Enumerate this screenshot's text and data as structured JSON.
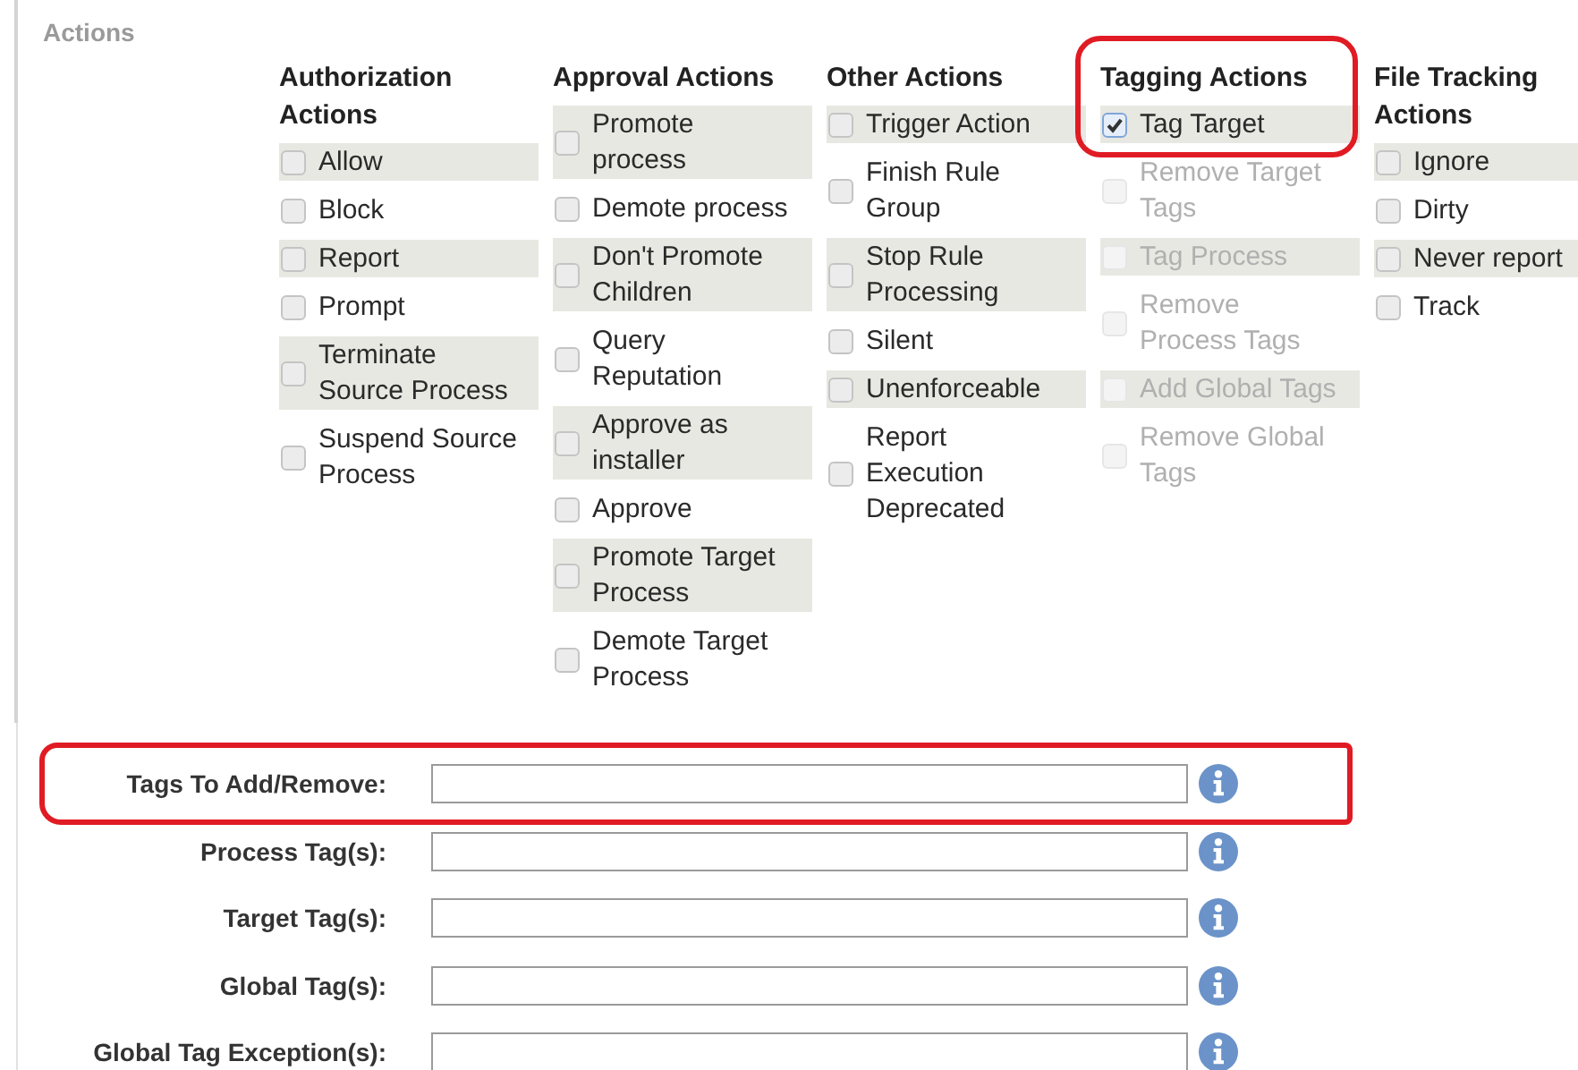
{
  "section": {
    "title": "Actions"
  },
  "action_groups": [
    {
      "title": "Authorization Actions",
      "highlighted": false,
      "options": [
        {
          "label": "Allow",
          "checked": false,
          "disabled": false
        },
        {
          "label": "Block",
          "checked": false,
          "disabled": false
        },
        {
          "label": "Report",
          "checked": false,
          "disabled": false
        },
        {
          "label": "Prompt",
          "checked": false,
          "disabled": false
        },
        {
          "label": "Terminate Source Process",
          "checked": false,
          "disabled": false
        },
        {
          "label": "Suspend Source Process",
          "checked": false,
          "disabled": false
        }
      ]
    },
    {
      "title": "Approval Actions",
      "highlighted": false,
      "options": [
        {
          "label": "Promote process",
          "checked": false,
          "disabled": false
        },
        {
          "label": "Demote process",
          "checked": false,
          "disabled": false
        },
        {
          "label": "Don't Promote Children",
          "checked": false,
          "disabled": false
        },
        {
          "label": "Query Reputation",
          "checked": false,
          "disabled": false
        },
        {
          "label": "Approve as installer",
          "checked": false,
          "disabled": false
        },
        {
          "label": "Approve",
          "checked": false,
          "disabled": false
        },
        {
          "label": "Promote Target Process",
          "checked": false,
          "disabled": false
        },
        {
          "label": "Demote Target Process",
          "checked": false,
          "disabled": false
        }
      ]
    },
    {
      "title": "Other Actions",
      "highlighted": false,
      "options": [
        {
          "label": "Trigger Action",
          "checked": false,
          "disabled": false
        },
        {
          "label": "Finish Rule Group",
          "checked": false,
          "disabled": false
        },
        {
          "label": "Stop Rule Processing",
          "checked": false,
          "disabled": false
        },
        {
          "label": "Silent",
          "checked": false,
          "disabled": false
        },
        {
          "label": "Unenforceable",
          "checked": false,
          "disabled": false
        },
        {
          "label": "Report Execution Deprecated",
          "checked": false,
          "disabled": false
        }
      ]
    },
    {
      "title": "Tagging Actions",
      "highlighted": true,
      "options": [
        {
          "label": "Tag Target",
          "checked": true,
          "disabled": false
        },
        {
          "label": "Remove Target Tags",
          "checked": false,
          "disabled": true
        },
        {
          "label": "Tag Process",
          "checked": false,
          "disabled": true
        },
        {
          "label": "Remove Process Tags",
          "checked": false,
          "disabled": true
        },
        {
          "label": "Add Global Tags",
          "checked": false,
          "disabled": true
        },
        {
          "label": "Remove Global Tags",
          "checked": false,
          "disabled": true
        }
      ]
    },
    {
      "title": "File Tracking Actions",
      "highlighted": false,
      "options": [
        {
          "label": "Ignore",
          "checked": false,
          "disabled": false
        },
        {
          "label": "Dirty",
          "checked": false,
          "disabled": false
        },
        {
          "label": "Never report",
          "checked": false,
          "disabled": false
        },
        {
          "label": "Track",
          "checked": false,
          "disabled": false
        }
      ]
    }
  ],
  "tag_fields": [
    {
      "label": "Tags To Add/Remove:",
      "highlighted": true
    },
    {
      "label": "Process Tag(s):",
      "highlighted": false
    },
    {
      "label": "Target Tag(s):",
      "highlighted": false
    },
    {
      "label": "Global Tag(s):",
      "highlighted": false
    },
    {
      "label": "Global Tag Exception(s):",
      "highlighted": false
    }
  ]
}
